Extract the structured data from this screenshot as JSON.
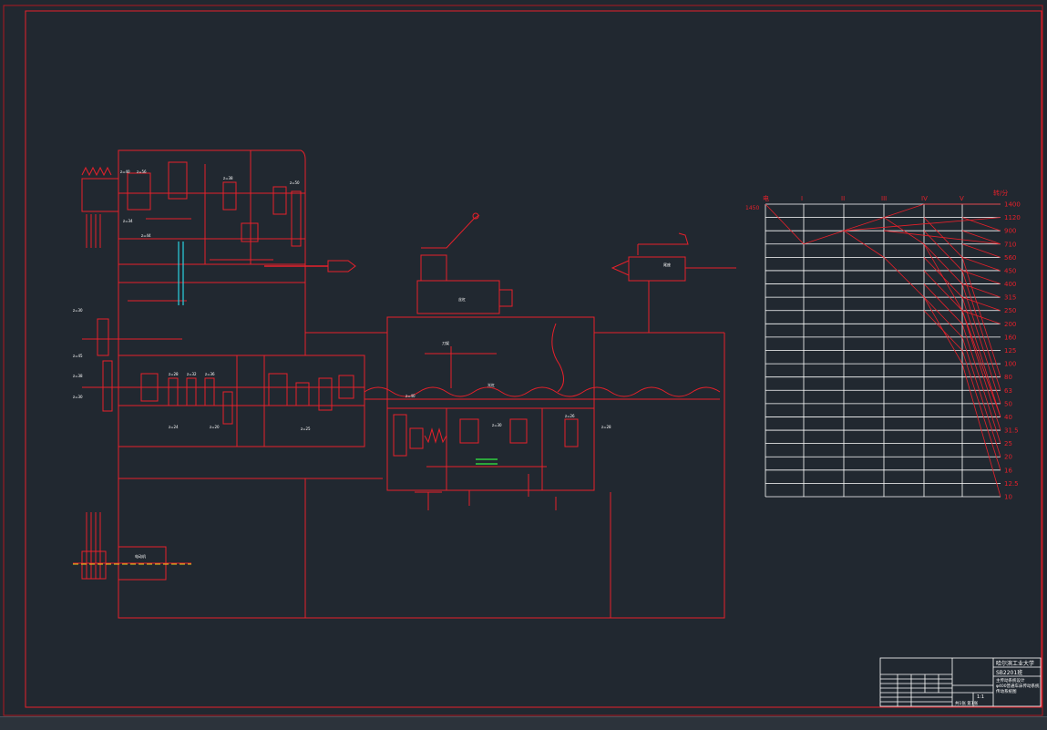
{
  "colors": {
    "background": "#212830",
    "line": "#e8202a",
    "text": "#ffffff",
    "cyan": "#29d3e0",
    "yellow": "#e6d21e",
    "green": "#30d040"
  },
  "speed_diagram": {
    "unit_label": "转/分",
    "column_labels": [
      "电",
      "I",
      "II",
      "III",
      "IV",
      "V"
    ],
    "motor_speed": "1450",
    "speed_values": [
      "1400",
      "1120",
      "900",
      "710",
      "560",
      "450",
      "400",
      "315",
      "250",
      "200",
      "160",
      "125",
      "100",
      "80",
      "63",
      "50",
      "40",
      "31.5",
      "25",
      "20",
      "16",
      "12.5",
      "10"
    ]
  },
  "title_block": {
    "school": "哈尔滨工业大学",
    "drawing_no": "SB2201班",
    "title_line1": "主传动系统设计",
    "title_line2": "φ400普通车床传动系统",
    "title_line3": "传动系统图",
    "scale": "1:1",
    "sheet_info": "共1张  第1张"
  }
}
